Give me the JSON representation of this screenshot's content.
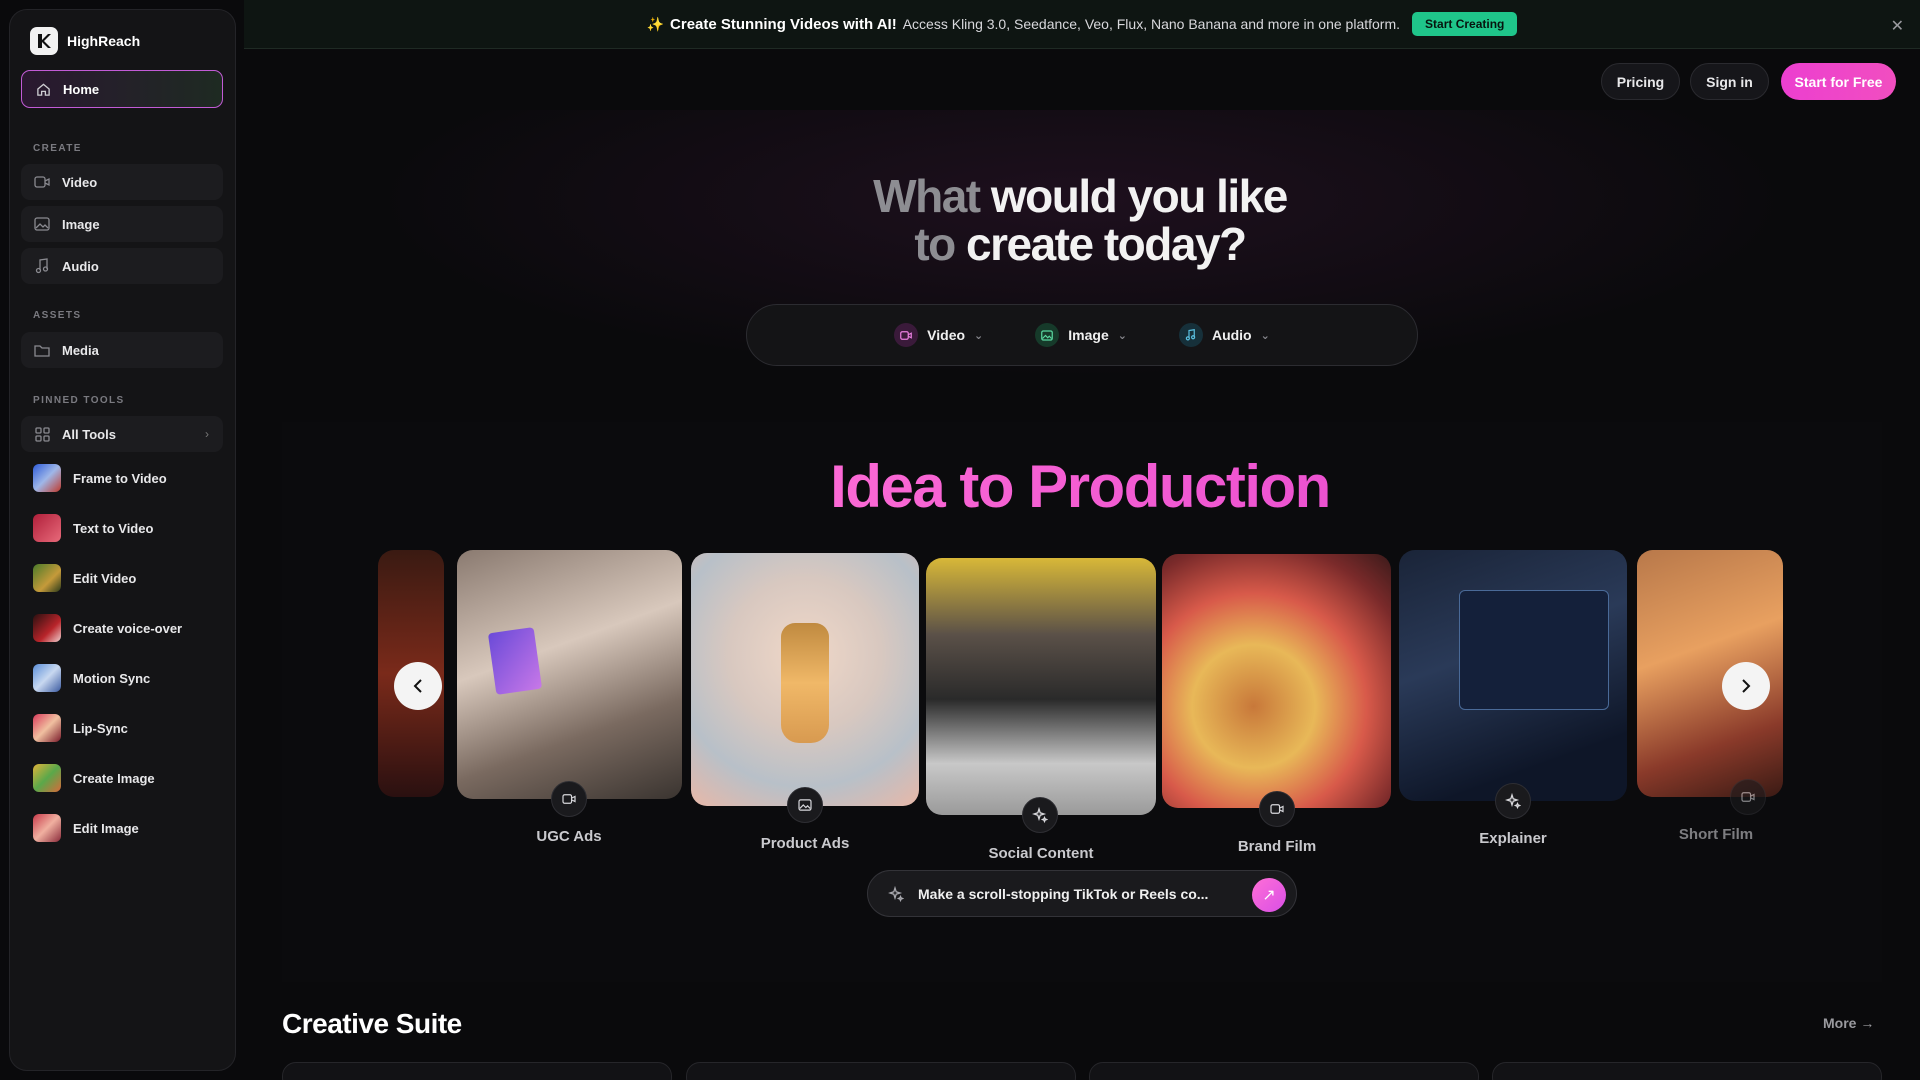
{
  "sidebar": {
    "brand": "HighReach",
    "home": "Home",
    "create_label": "CREATE",
    "create_items": [
      {
        "label": "Video",
        "icon": "video-icon"
      },
      {
        "label": "Image",
        "icon": "image-icon"
      },
      {
        "label": "Audio",
        "icon": "music-icon"
      }
    ],
    "assets_label": "ASSETS",
    "assets_items": [
      {
        "label": "Media",
        "icon": "folder-icon"
      }
    ],
    "pinned_label": "PINNED TOOLS",
    "all_tools": "All Tools",
    "tools": [
      {
        "label": "Frame to Video"
      },
      {
        "label": "Text to Video"
      },
      {
        "label": "Edit Video"
      },
      {
        "label": "Create voice-over"
      },
      {
        "label": "Motion Sync"
      },
      {
        "label": "Lip-Sync"
      },
      {
        "label": "Create Image"
      },
      {
        "label": "Edit Image"
      }
    ]
  },
  "banner": {
    "title": "Create Stunning Videos with AI!",
    "subtitle": "Access Kling 3.0, Seedance, Veo, Flux, Nano Banana and more in one platform.",
    "cta": "Start Creating"
  },
  "header": {
    "pricing": "Pricing",
    "signin": "Sign in",
    "start_free": "Start for Free"
  },
  "hero": {
    "title_dim_1": "What",
    "title_1": "would you like",
    "title_dim_2": "to",
    "title_2": "create today?",
    "pickers": [
      {
        "label": "Video",
        "icon": "video-icon"
      },
      {
        "label": "Image",
        "icon": "image-icon"
      },
      {
        "label": "Audio",
        "icon": "music-icon"
      }
    ]
  },
  "carousel": {
    "title": "Idea to Production",
    "cards": [
      {
        "label": "UGC Ads",
        "icon": "video-icon"
      },
      {
        "label": "Product Ads",
        "icon": "image-icon"
      },
      {
        "label": "Social Content",
        "icon": "sparkle-icon"
      },
      {
        "label": "Brand Film",
        "icon": "video-icon"
      },
      {
        "label": "Explainer",
        "icon": "sparkle-icon"
      },
      {
        "label": "Short Film",
        "icon": "video-icon"
      }
    ],
    "prompt": "Make a scroll-stopping TikTok or Reels co..."
  },
  "suite": {
    "title": "Creative Suite",
    "more": "More"
  },
  "colors": {
    "accent_pink": "#ec3fd0",
    "accent_green": "#1fc58a",
    "background": "#0a0a0c"
  }
}
